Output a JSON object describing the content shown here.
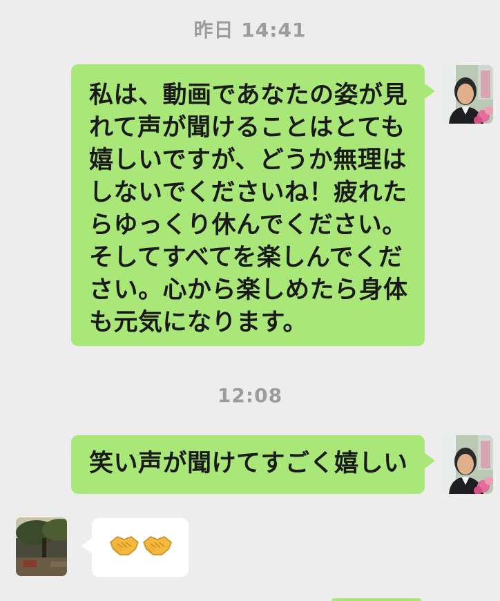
{
  "chat": {
    "timestamps": [
      "昨日 14:41",
      "12:08"
    ],
    "messages": [
      {
        "side": "right",
        "text": "私は、動画であなたの姿が見\nれて声が聞けることはとても\n嬉しいですが、どうか無理は\nしないでくださいね！疲れた\nらゆっくり休んでください。\nそしてすべてを楽しんでくだ\nさい。心から楽しめたら身体\nも元気になります。",
        "avatar": "self-avatar"
      },
      {
        "side": "right",
        "text": "笑い声が聞けてすごく嬉しい",
        "avatar": "self-avatar"
      },
      {
        "side": "left",
        "emoji": [
          "handshake-emoji",
          "handshake-emoji"
        ],
        "avatar": "friend-avatar"
      }
    ]
  },
  "colors": {
    "background": "#ededed",
    "outgoing_bubble": "#a9e878",
    "incoming_bubble": "#ffffff",
    "timestamp": "#9c9c9c",
    "text": "#1a1a1a"
  }
}
